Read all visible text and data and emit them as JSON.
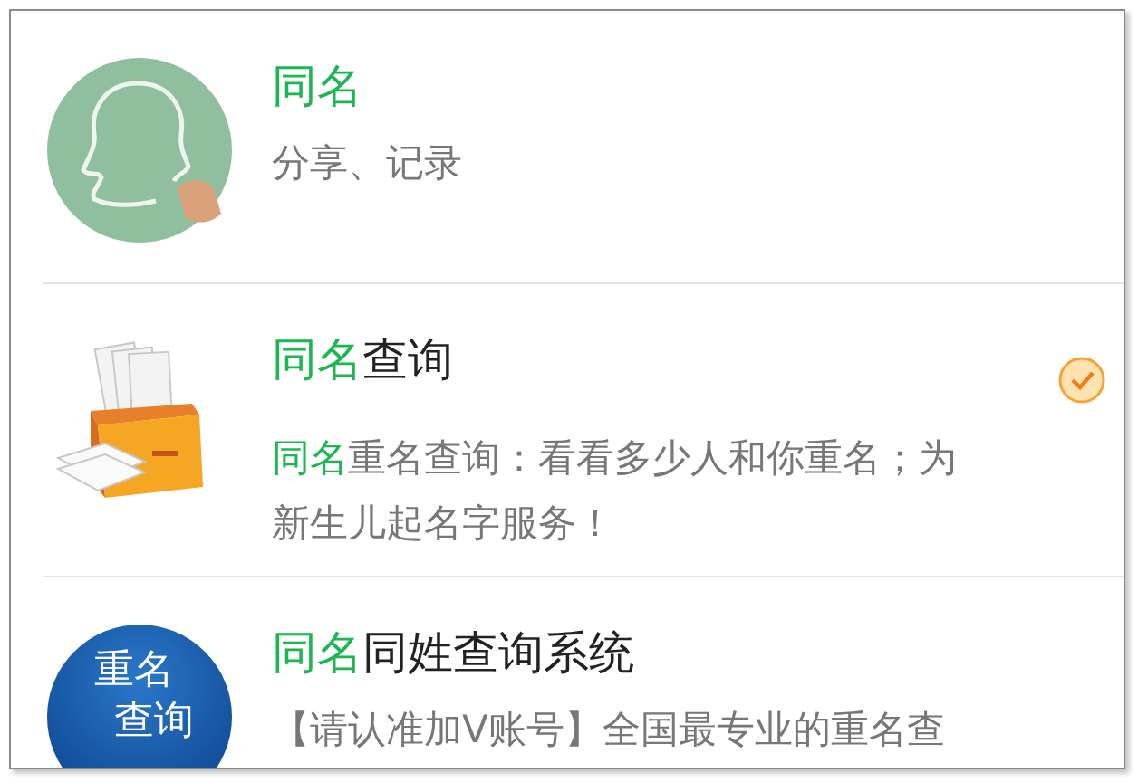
{
  "results": [
    {
      "kind": "chalk",
      "title_match": "同名",
      "desc": "分享、记录",
      "verified": false
    },
    {
      "kind": "drawer",
      "title_match": "同名",
      "title_rest": "查询",
      "desc_match": "同名",
      "desc": "重名查询：看看多少人和你重名；为新生儿起名字服务！",
      "verified": true
    },
    {
      "kind": "badge",
      "badge_lines": [
        "重名",
        "查询"
      ],
      "title_match": "同名",
      "title_rest": "同姓查询系统",
      "desc": "【请认准加V账号】全国最专业的重名查",
      "verified": false
    }
  ]
}
